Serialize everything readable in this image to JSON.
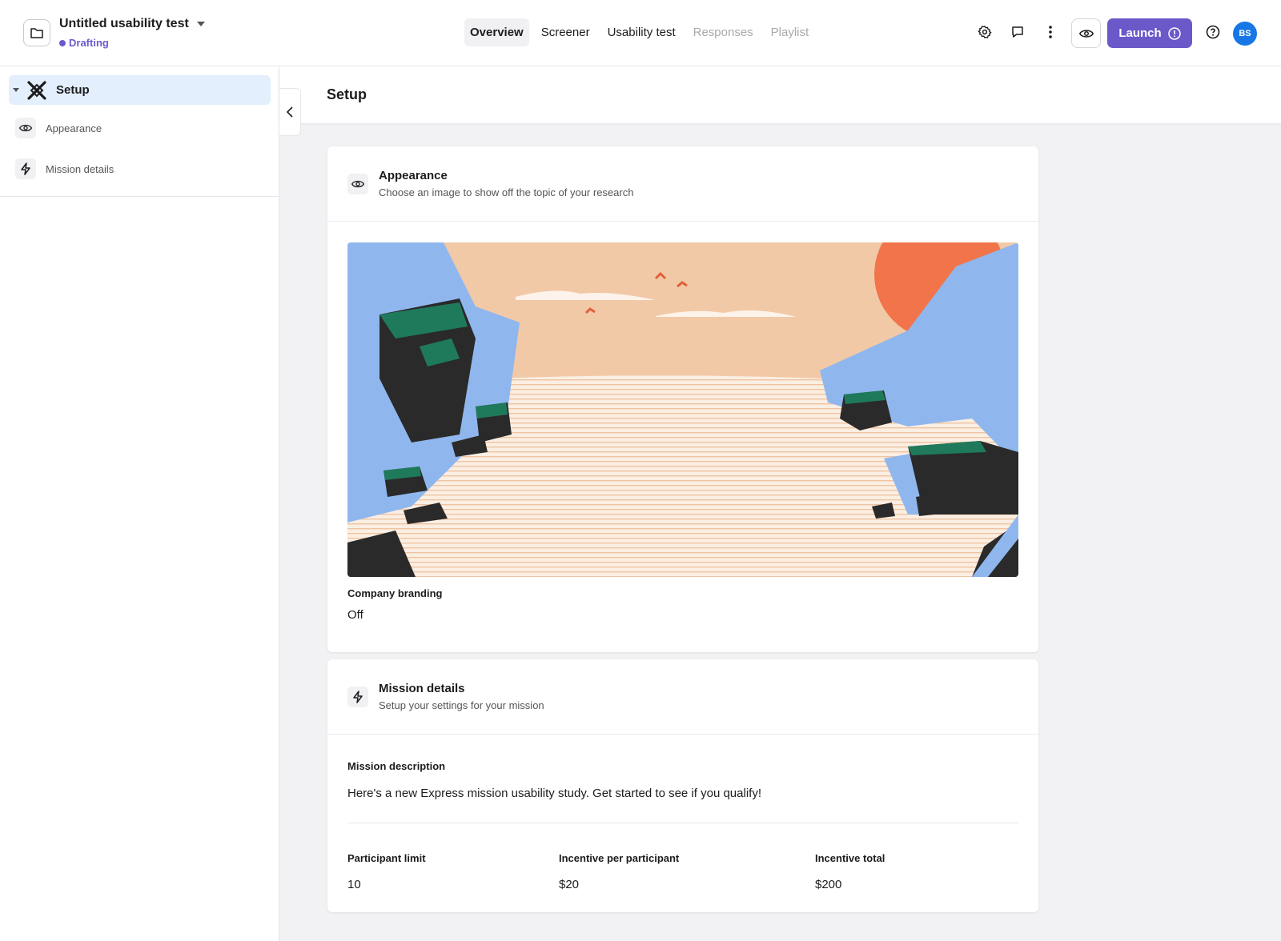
{
  "header": {
    "project_title": "Untitled usability test",
    "status": "Drafting",
    "tabs": [
      {
        "label": "Overview",
        "state": "active"
      },
      {
        "label": "Screener",
        "state": "normal"
      },
      {
        "label": "Usability test",
        "state": "normal"
      },
      {
        "label": "Responses",
        "state": "disabled"
      },
      {
        "label": "Playlist",
        "state": "disabled"
      }
    ],
    "launch_label": "Launch",
    "avatar_initials": "BS",
    "icons": [
      "folder-icon",
      "gear-icon",
      "comment-icon",
      "more-vertical-icon",
      "eye-icon",
      "info-icon",
      "help-icon"
    ]
  },
  "sidebar": {
    "setup_label": "Setup",
    "items": [
      {
        "label": "Appearance",
        "icon": "eye-icon"
      },
      {
        "label": "Mission details",
        "icon": "lightning-icon"
      }
    ]
  },
  "main": {
    "title": "Setup",
    "appearance": {
      "title": "Appearance",
      "subtitle": "Choose an image to show off the topic of your research",
      "branding_label": "Company branding",
      "branding_value": "Off"
    },
    "mission": {
      "title": "Mission details",
      "subtitle": "Setup your settings for your mission",
      "description_label": "Mission description",
      "description_value": "Here's a new Express mission usability study. Get started to see if you qualify!",
      "participant_limit_label": "Participant limit",
      "participant_limit_value": "10",
      "incentive_per_label": "Incentive per participant",
      "incentive_per_value": "$20",
      "incentive_total_label": "Incentive total",
      "incentive_total_value": "$200"
    }
  },
  "colors": {
    "accent": "#6b58c9",
    "avatar": "#1877e6",
    "sidebar_active": "#e3effd",
    "sky": "#f2c9a7",
    "sun": "#f2744a",
    "rock_blue": "#8fb7ee",
    "rock_green": "#1f7a5c"
  }
}
